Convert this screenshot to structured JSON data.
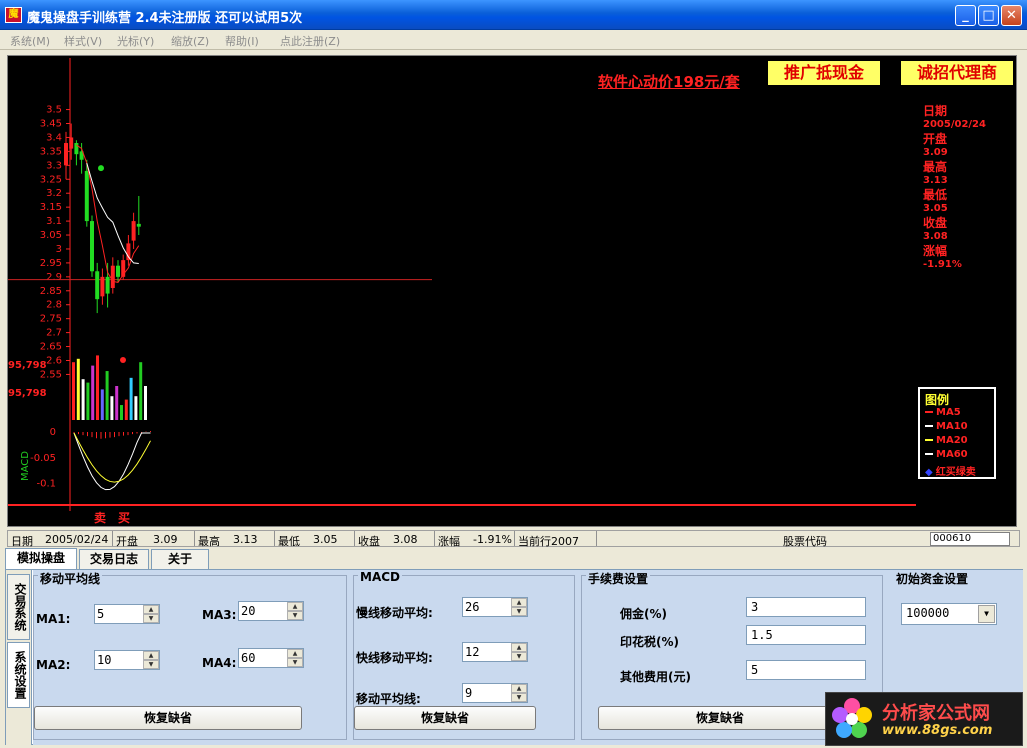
{
  "window": {
    "title": "魔鬼操盘手训练营  2.4未注册版   还可以试用5次",
    "icon_name": "app-logo-icon"
  },
  "menu": [
    "系统(M)",
    "样式(V)",
    "光标(Y)",
    "缩放(Z)",
    "帮助(I)",
    "点此注册(Z)"
  ],
  "promo": {
    "link": "软件心动价198元/套",
    "cash": "推广抵现金",
    "agent": "诚招代理商"
  },
  "info": {
    "date_label": "日期",
    "date": "2005/02/24",
    "open_label": "开盘",
    "open": "3.09",
    "high_label": "最高",
    "high": "3.13",
    "low_label": "最低",
    "low": "3.05",
    "close_label": "收盘",
    "close": "3.08",
    "change_label": "涨幅",
    "change": "-1.91%"
  },
  "legend": {
    "title": "图例",
    "items": [
      {
        "label": "MA5",
        "color": "#ff2222"
      },
      {
        "label": "MA10",
        "color": "#ffffff"
      },
      {
        "label": "MA20",
        "color": "#ffff33"
      },
      {
        "label": "MA60",
        "color": "#ffffff"
      },
      {
        "label": "红买绿卖",
        "color": "#2222ff"
      }
    ]
  },
  "chart_data": {
    "type": "candlestick",
    "price_ticks": [
      "3.5",
      "3.45",
      "3.4",
      "3.35",
      "3.3",
      "3.25",
      "3.2",
      "3.15",
      "3.1",
      "3.05",
      "3",
      "2.95",
      "2.9",
      "2.85",
      "2.8",
      "2.75",
      "2.7",
      "2.65",
      "2.6",
      "2.55"
    ],
    "ylim": [
      2.53,
      3.52
    ],
    "volume_labels": [
      "95,798",
      "95,798"
    ],
    "macd_label": "MACD",
    "macd_ticks": [
      "0",
      "-0.05",
      "-0.1"
    ],
    "macd_ylim": [
      -0.12,
      0.0
    ],
    "crosshair_price": 2.89,
    "candles": [
      {
        "o": 3.3,
        "h": 3.42,
        "l": 3.25,
        "c": 3.38
      },
      {
        "o": 3.36,
        "h": 3.45,
        "l": 3.32,
        "c": 3.4
      },
      {
        "o": 3.38,
        "h": 3.39,
        "l": 3.3,
        "c": 3.34
      },
      {
        "o": 3.35,
        "h": 3.38,
        "l": 3.27,
        "c": 3.32
      },
      {
        "o": 3.28,
        "h": 3.32,
        "l": 3.08,
        "c": 3.1
      },
      {
        "o": 3.1,
        "h": 3.12,
        "l": 2.9,
        "c": 2.92
      },
      {
        "o": 2.92,
        "h": 2.95,
        "l": 2.77,
        "c": 2.82
      },
      {
        "o": 2.83,
        "h": 2.93,
        "l": 2.8,
        "c": 2.9
      },
      {
        "o": 2.9,
        "h": 2.95,
        "l": 2.79,
        "c": 2.84
      },
      {
        "o": 2.86,
        "h": 2.97,
        "l": 2.84,
        "c": 2.94
      },
      {
        "o": 2.94,
        "h": 2.96,
        "l": 2.88,
        "c": 2.9
      },
      {
        "o": 2.9,
        "h": 2.98,
        "l": 2.89,
        "c": 2.96
      },
      {
        "o": 2.96,
        "h": 3.05,
        "l": 2.94,
        "c": 3.02
      },
      {
        "o": 3.03,
        "h": 3.13,
        "l": 3.0,
        "c": 3.1
      },
      {
        "o": 3.09,
        "h": 3.19,
        "l": 3.05,
        "c": 3.08
      }
    ],
    "volumes": [
      0.85,
      0.9,
      0.6,
      0.55,
      0.8,
      0.95,
      0.45,
      0.72,
      0.35,
      0.5,
      0.22,
      0.3,
      0.62,
      0.35,
      0.85,
      0.5
    ],
    "volume_colors": [
      "#ff2222",
      "#ffff33",
      "#ffffff",
      "#22cc22",
      "#cc33cc",
      "#ff2222",
      "#6666ff",
      "#22cc22",
      "#ffffff",
      "#cc33cc",
      "#22cc22",
      "#ff2222",
      "#33ccff",
      "#ffffff",
      "#22cc22",
      "#ffffff"
    ],
    "macd_hist": [
      -0.002,
      -0.004,
      -0.006,
      -0.008,
      -0.01,
      -0.012,
      -0.013,
      -0.012,
      -0.011,
      -0.01,
      -0.008,
      -0.007,
      -0.006,
      -0.004,
      -0.003,
      -0.002,
      0.001,
      0.002
    ],
    "trade_marks": [
      "卖",
      "买"
    ]
  },
  "status": {
    "date_label": "日期",
    "date": "2005/02/24",
    "open_label": "开盘",
    "open": "3.09",
    "high_label": "最高",
    "high": "3.13",
    "low_label": "最低",
    "low": "3.05",
    "close_label": "收盘",
    "close": "3.08",
    "change_label": "涨幅",
    "change": "-1.91%",
    "row": "当前行2007",
    "code_label": "股票代码",
    "code": "000610"
  },
  "tabs": [
    "模拟操盘",
    "交易日志",
    "关于"
  ],
  "vtabs": [
    "交易系统",
    "系统设置"
  ],
  "ma_group": {
    "title": "移动平均线",
    "ma1_label": "MA1:",
    "ma1": "5",
    "ma2_label": "MA2:",
    "ma2": "10",
    "ma3_label": "MA3:",
    "ma3": "20",
    "ma4_label": "MA4:",
    "ma4": "60",
    "reset": "恢复缺省"
  },
  "macd_group": {
    "title": "MACD",
    "slow_label": "慢线移动平均:",
    "slow": "26",
    "fast_label": "快线移动平均:",
    "fast": "12",
    "signal_label": "移动平均线:",
    "signal": "9",
    "reset": "恢复缺省"
  },
  "fee_group": {
    "title": "手续费设置",
    "commission_label": "佣金(%)",
    "commission": "3",
    "stamp_label": "印花税(%)",
    "stamp": "1.5",
    "other_label": "其他费用(元)",
    "other": "5",
    "reset": "恢复缺省"
  },
  "capital_group": {
    "title": "初始资金设置",
    "value": "100000"
  },
  "watermark": {
    "text": "分析家公式网",
    "url": "www.88gs.com"
  }
}
